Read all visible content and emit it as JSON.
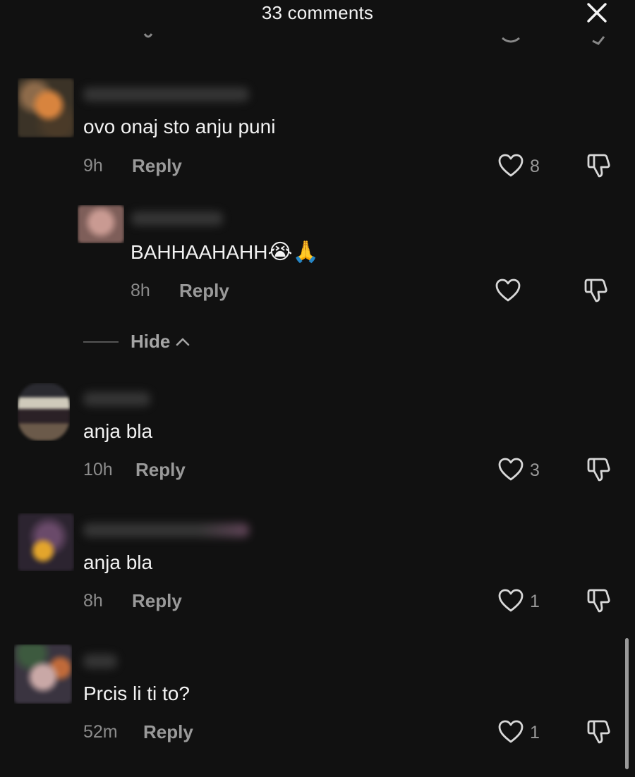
{
  "header": {
    "title": "33 comments",
    "close_icon": "close-icon"
  },
  "comments": [
    {
      "text": "ovo onaj sto anju puni",
      "time": "9h",
      "reply_label": "Reply",
      "likes": "8",
      "reply": {
        "text": "BAHHAAHAHH",
        "emojis": "😭🙏",
        "time": "8h",
        "reply_label": "Reply"
      },
      "hide_label": "Hide"
    },
    {
      "text": "anja bla",
      "time": "10h",
      "reply_label": "Reply",
      "likes": "3"
    },
    {
      "text": "anja bla",
      "time": "8h",
      "reply_label": "Reply",
      "likes": "1"
    },
    {
      "text": "Prcis li ti to?",
      "time": "52m",
      "reply_label": "Reply",
      "likes": "1"
    }
  ],
  "colors": {
    "background": "#111111",
    "text": "#f2f2f2",
    "muted": "#8c8c8c"
  }
}
